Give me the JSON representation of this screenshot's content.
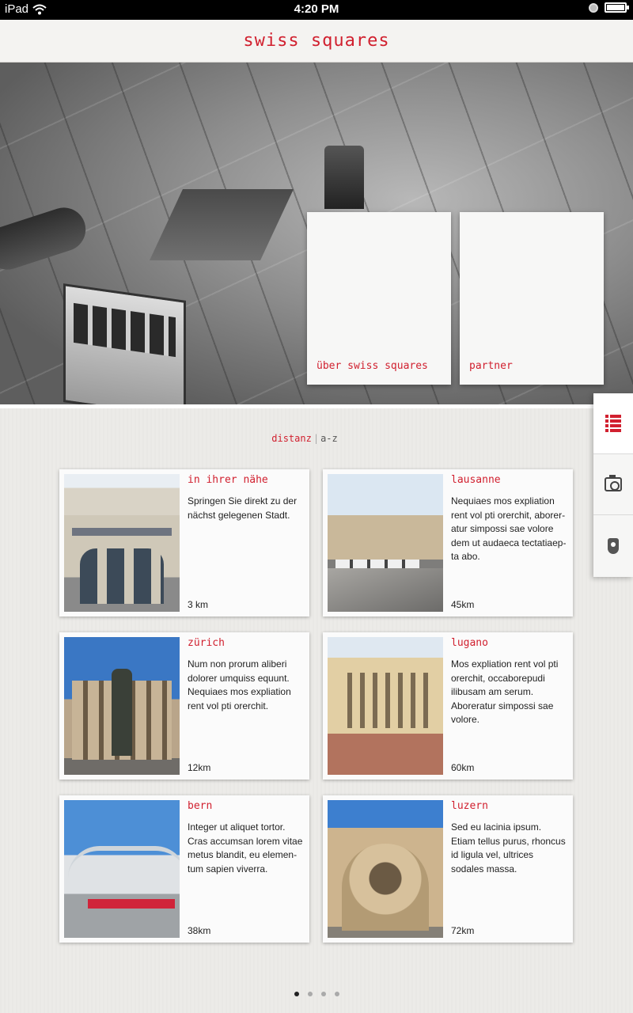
{
  "status": {
    "carrier": "iPad",
    "time": "4:20 PM"
  },
  "header": {
    "title": "swiss squares"
  },
  "hero": {
    "tiles": [
      {
        "label": "über swiss squares"
      },
      {
        "label": "partner"
      }
    ]
  },
  "side_tabs": [
    {
      "icon": "list-icon",
      "active": true
    },
    {
      "icon": "camera-icon",
      "active": false
    },
    {
      "icon": "map-pin-icon",
      "active": false
    }
  ],
  "sort": {
    "active": "distanz",
    "separator": "|",
    "inactive": "a-z"
  },
  "cards": [
    {
      "title": "in ihrer nähe",
      "desc": "Springen Sie direkt zu der nächst gelegenen Stadt.",
      "dist": "3 km"
    },
    {
      "title": "lausanne",
      "desc": "Nequiaes mos expliation rent vol pti orerchit, aborer­atur simpossi sae volore dem ut audaeca tectatiaep­ta abo.",
      "dist": "45km"
    },
    {
      "title": "zürich",
      "desc": "Num non prorum aliberi do­lorer umquiss equunt. Nequiaes mos expliation rent vol pti orerchit.",
      "dist": "12km"
    },
    {
      "title": "lugano",
      "desc": "Mos expliation rent vol pti orerchit, occaborepudi ilibusam am serum. Aborer­atur simpossi sae volore.",
      "dist": "60km"
    },
    {
      "title": "bern",
      "desc": "Integer ut aliquet tortor. Cras accumsan lorem vitae metus blandit, eu elemen­tum sapien viverra.",
      "dist": "38km"
    },
    {
      "title": "luzern",
      "desc": "Sed eu lacinia ipsum. Etiam tellus purus, rhoncus id ligula vel, ultrices sodales massa.",
      "dist": "72km"
    }
  ],
  "pager": {
    "pages": 4,
    "current": 1
  },
  "colors": {
    "accent": "#d1202f"
  }
}
